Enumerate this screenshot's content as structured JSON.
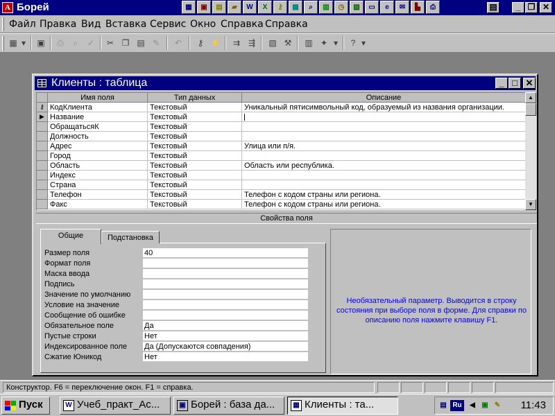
{
  "app": {
    "title": "Борей",
    "icon": "access-key-icon"
  },
  "window_controls": {
    "minimize": "_",
    "restore": "❐",
    "close": "✕"
  },
  "office_bar": [
    "office-icon",
    "access-icon",
    "notes-icon",
    "folder-icon",
    "word-icon",
    "excel-icon",
    "key-icon",
    "note-icon",
    "search-icon",
    "calendar-icon",
    "clock-icon",
    "publisher-icon",
    "doc-icon",
    "ie-icon",
    "mail-icon",
    "printer-icon",
    "print-icon",
    "outlook-icon"
  ],
  "menu": [
    "Файл",
    "Правка",
    "Вид",
    "Вставка",
    "Сервис",
    "Окно",
    "Справка",
    "Справка"
  ],
  "child_window": {
    "title": "Клиенты : таблица",
    "min": "_",
    "max": "□",
    "close": "✕"
  },
  "table": {
    "columns": [
      "Имя поля",
      "Тип данных",
      "Описание"
    ],
    "rows": [
      {
        "field": "КодКлиента",
        "type": "Текстовый",
        "desc": "Уникальный пятисимвольный код, образуемый из названия организации.",
        "marker": "key"
      },
      {
        "field": "Название",
        "type": "Текстовый",
        "desc": "",
        "marker": "current"
      },
      {
        "field": "ОбращатьсяК",
        "type": "Текстовый",
        "desc": "",
        "marker": ""
      },
      {
        "field": "Должность",
        "type": "Текстовый",
        "desc": "",
        "marker": ""
      },
      {
        "field": "Адрес",
        "type": "Текстовый",
        "desc": "Улица или п/я.",
        "marker": ""
      },
      {
        "field": "Город",
        "type": "Текстовый",
        "desc": "",
        "marker": ""
      },
      {
        "field": "Область",
        "type": "Текстовый",
        "desc": "Область или республика.",
        "marker": ""
      },
      {
        "field": "Индекс",
        "type": "Текстовый",
        "desc": "",
        "marker": ""
      },
      {
        "field": "Страна",
        "type": "Текстовый",
        "desc": "",
        "marker": ""
      },
      {
        "field": "Телефон",
        "type": "Текстовый",
        "desc": "Телефон с кодом страны или региона.",
        "marker": ""
      },
      {
        "field": "Факс",
        "type": "Текстовый",
        "desc": "Телефон с кодом страны или региона.",
        "marker": ""
      }
    ]
  },
  "properties": {
    "header": "Свойства поля",
    "tabs": [
      "Общие",
      "Подстановка"
    ],
    "fields": [
      {
        "label": "Размер поля",
        "value": "40"
      },
      {
        "label": "Формат поля",
        "value": ""
      },
      {
        "label": "Маска ввода",
        "value": ""
      },
      {
        "label": "Подпись",
        "value": ""
      },
      {
        "label": "Значение по умолчанию",
        "value": ""
      },
      {
        "label": "Условие на значение",
        "value": ""
      },
      {
        "label": "Сообщение об ошибке",
        "value": ""
      },
      {
        "label": "Обязательное поле",
        "value": "Да"
      },
      {
        "label": "Пустые строки",
        "value": "Нет"
      },
      {
        "label": "Индексированное поле",
        "value": "Да (Допускаются совпадения)"
      },
      {
        "label": "Сжатие Юникод",
        "value": "Нет"
      }
    ],
    "help": "Необязательный параметр.  Выводится в строку состояния при выборе поля в форме.  Для справки по описанию поля нажмите клавишу F1."
  },
  "status": "Конструктор.  F6 = переключение окон.  F1 = справка.",
  "taskbar": {
    "start": "Пуск",
    "tasks": [
      {
        "label": "Учеб_практ_Ас...",
        "icon": "word-icon"
      },
      {
        "label": "Борей : база да...",
        "icon": "database-icon"
      },
      {
        "label": "Клиенты : та...",
        "icon": "table-icon"
      }
    ],
    "tray": {
      "lang": "Ru",
      "clock": "11:43"
    }
  },
  "colors": {
    "titlebar": "#000080",
    "face": "#c0c0c0",
    "desktop": "#808080",
    "help_text": "#0000ff"
  }
}
